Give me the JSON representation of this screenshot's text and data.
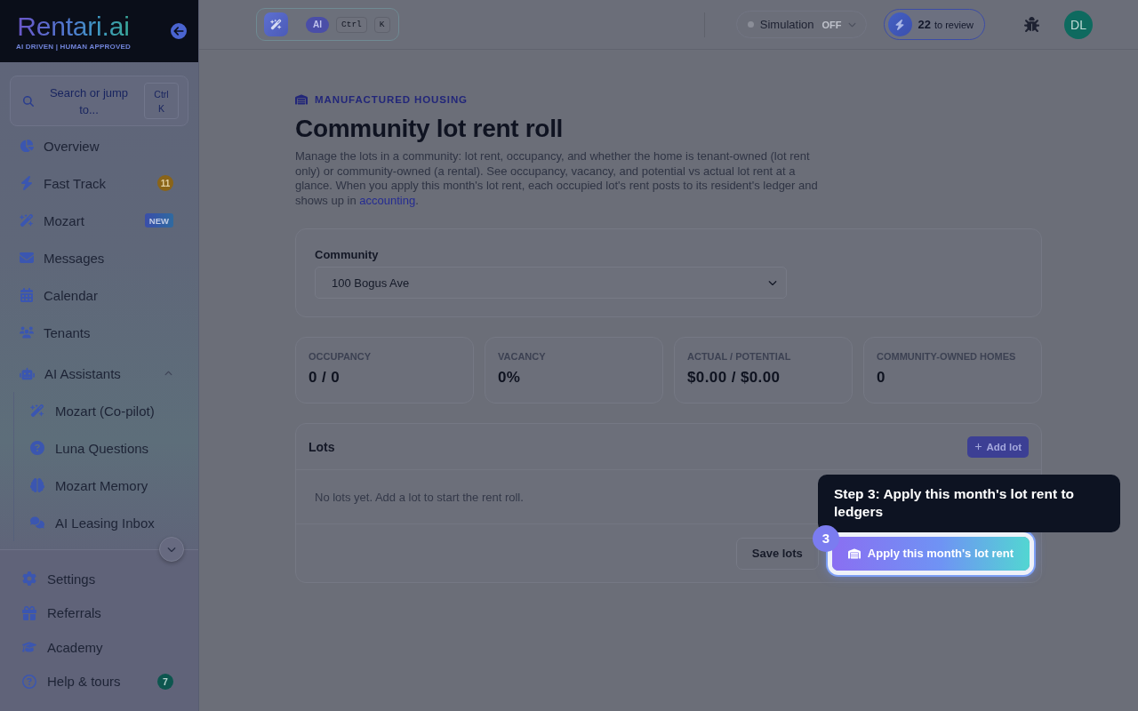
{
  "sidebar": {
    "logo": {
      "name": "Rentari.ai",
      "tagline": "AI DRIVEN | HUMAN APPROVED"
    },
    "search": {
      "label": "Search or jump to...",
      "shortcut": "Ctrl K"
    },
    "nav": [
      {
        "label": "Overview"
      },
      {
        "label": "Fast Track",
        "badge": {
          "text": "11",
          "kind": "count"
        }
      },
      {
        "label": "Mozart",
        "badge": {
          "text": "NEW",
          "kind": "new"
        }
      },
      {
        "label": "Messages"
      },
      {
        "label": "Calendar"
      },
      {
        "label": "Tenants"
      },
      {
        "label": "AI Assistants",
        "expanded": true,
        "children": [
          {
            "label": "Mozart (Co-pilot)"
          },
          {
            "label": "Luna Questions"
          },
          {
            "label": "Mozart Memory"
          },
          {
            "label": "AI Leasing Inbox"
          }
        ]
      }
    ],
    "footer_nav": [
      {
        "label": "Settings"
      },
      {
        "label": "Referrals"
      },
      {
        "label": "Academy"
      },
      {
        "label": "Help & tours",
        "badge": {
          "text": "7",
          "kind": "status"
        }
      }
    ]
  },
  "topbar": {
    "ai_command": {
      "badge": "AI",
      "keys": [
        "Ctrl",
        "K"
      ]
    },
    "simulation": {
      "label": "Simulation",
      "status": "OFF",
      "on": false
    },
    "review": {
      "count": "22",
      "label": "to review"
    },
    "avatar": {
      "initials": "DL"
    }
  },
  "page": {
    "eyebrow": "MANUFACTURED HOUSING",
    "title": "Community lot rent roll",
    "description": {
      "text": "Manage the lots in a community: lot rent, occupancy, and whether the home is tenant-owned (lot rent only) or community-owned (a rental). See occupancy, vacancy, and potential vs actual lot rent at a glance. When you apply this month's lot rent, each occupied lot's rent posts to its resident's ledger and shows up in",
      "link": "accounting",
      "after": "."
    },
    "community": {
      "label": "Community",
      "value": "100 Bogus Ave"
    },
    "stats": [
      {
        "label": "OCCUPANCY",
        "value": "0 / 0"
      },
      {
        "label": "VACANCY",
        "value": "0%"
      },
      {
        "label": "ACTUAL / POTENTIAL",
        "value": "$0.00 / $0.00"
      },
      {
        "label": "COMMUNITY-OWNED HOMES",
        "value": "0"
      }
    ],
    "lots": {
      "title": "Lots",
      "add_button": "Add lot",
      "empty": "No lots yet. Add a lot to start the rent roll.",
      "buttons": [
        {
          "label": "Save lots",
          "kind": "secondary",
          "highlighted": false
        },
        {
          "label": "Apply this month's lot rent",
          "kind": "primary",
          "highlighted": true
        }
      ]
    }
  },
  "tour": {
    "step": "3",
    "text": "Step 3: Apply this month's lot rent to ledgers"
  }
}
